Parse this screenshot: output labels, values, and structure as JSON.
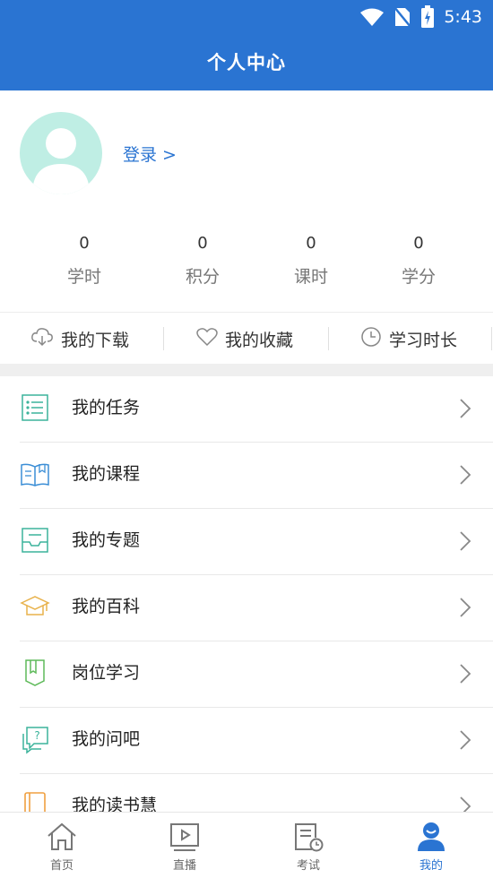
{
  "status_bar": {
    "time": "5:43"
  },
  "header": {
    "title": "个人中心"
  },
  "profile": {
    "login_label": "登录 >"
  },
  "stats": [
    {
      "value": "0",
      "label": "学时"
    },
    {
      "value": "0",
      "label": "积分"
    },
    {
      "value": "0",
      "label": "课时"
    },
    {
      "value": "0",
      "label": "学分"
    }
  ],
  "quick_links": [
    {
      "label": "我的下载",
      "icon": "cloud-download-icon"
    },
    {
      "label": "我的收藏",
      "icon": "heart-icon"
    },
    {
      "label": "学习时长",
      "icon": "clock-icon"
    }
  ],
  "menu": [
    {
      "label": "我的任务",
      "icon": "task-list-icon"
    },
    {
      "label": "我的课程",
      "icon": "open-book-icon"
    },
    {
      "label": "我的专题",
      "icon": "topic-inbox-icon"
    },
    {
      "label": "我的百科",
      "icon": "graduation-cap-icon"
    },
    {
      "label": "岗位学习",
      "icon": "bookmark-book-icon"
    },
    {
      "label": "我的问吧",
      "icon": "question-chat-icon"
    },
    {
      "label": "我的读书慧",
      "icon": "book-icon"
    }
  ],
  "tabs": [
    {
      "label": "首页",
      "icon": "home-icon"
    },
    {
      "label": "直播",
      "icon": "live-play-icon"
    },
    {
      "label": "考试",
      "icon": "exam-icon"
    },
    {
      "label": "我的",
      "icon": "user-icon",
      "active": true
    }
  ],
  "colors": {
    "brand": "#2a74d2",
    "avatar_bg": "#bfeee4"
  }
}
